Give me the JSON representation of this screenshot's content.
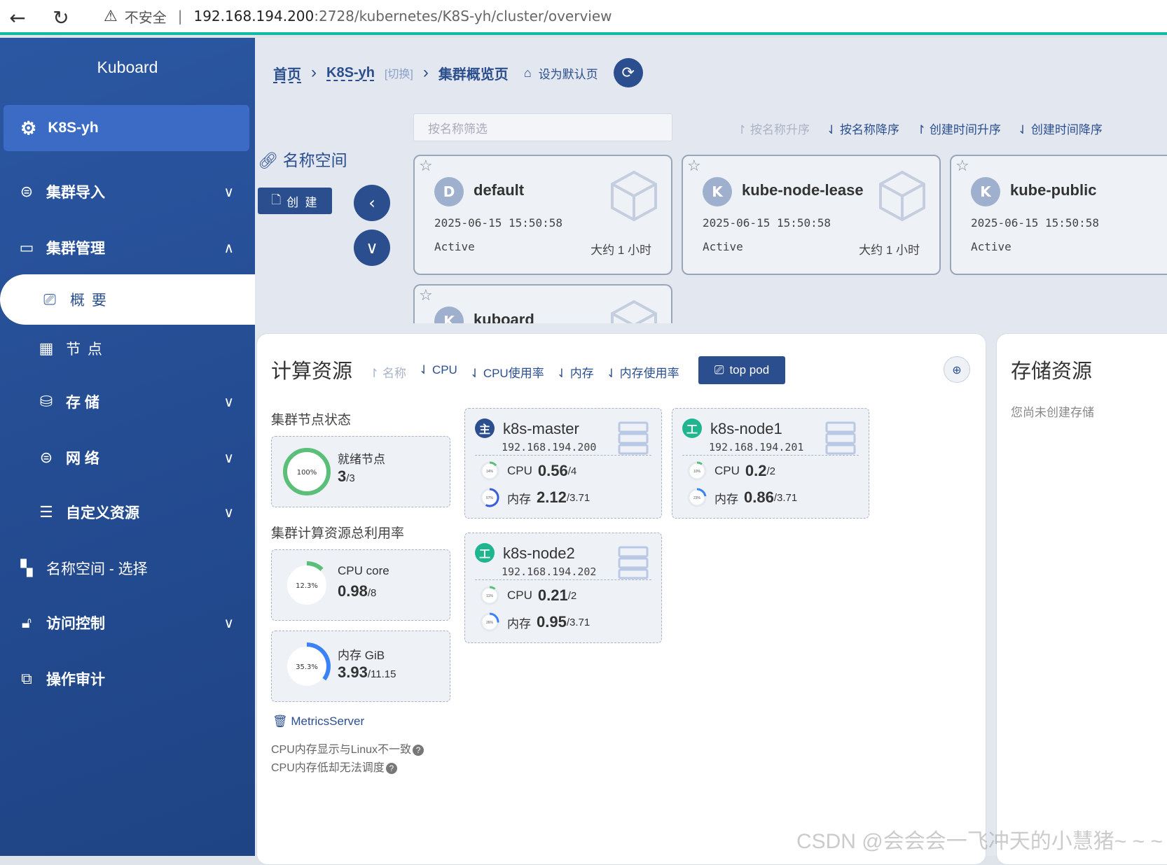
{
  "browser": {
    "insecure": "不安全",
    "url_host": "192.168.194.200",
    "url_path": ":2728/kubernetes/K8S-yh/cluster/overview"
  },
  "sidebar": {
    "brand": "Kuboard",
    "cluster": "K8S-yh",
    "items": [
      {
        "label": "集群导入"
      },
      {
        "label": "集群管理"
      },
      {
        "label": "概 要"
      },
      {
        "label": "节 点"
      },
      {
        "label": "存 储"
      },
      {
        "label": "网 络"
      },
      {
        "label": "自定义资源"
      },
      {
        "label": "名称空间 - 选择"
      },
      {
        "label": "访问控制"
      },
      {
        "label": "操作审计"
      }
    ]
  },
  "breadcrumb": {
    "home": "首页",
    "cluster": "K8S-yh",
    "switch": "[切换]",
    "current": "集群概览页",
    "set_default": "设为默认页"
  },
  "namespaces": {
    "label": "名称空间",
    "create": "创 建",
    "filter_placeholder": "按名称筛选",
    "sorts": [
      "按名称升序",
      "按名称降序",
      "创建时间升序",
      "创建时间降序"
    ],
    "cards": [
      {
        "initial": "D",
        "name": "default",
        "created": "2025-06-15 15:50:58",
        "status": "Active",
        "age": "大约 1 小时"
      },
      {
        "initial": "K",
        "name": "kube-node-lease",
        "created": "2025-06-15 15:50:58",
        "status": "Active",
        "age": "大约 1 小时"
      },
      {
        "initial": "K",
        "name": "kube-public",
        "created": "2025-06-15 15:50:58",
        "status": "Active",
        "age": ""
      },
      {
        "initial": "K",
        "name": "kuboard",
        "created": "",
        "status": "",
        "age": ""
      }
    ]
  },
  "compute": {
    "title": "计算资源",
    "sorts": [
      "名称",
      "CPU",
      "CPU使用率",
      "内存",
      "内存使用率"
    ],
    "top_pod": "top pod",
    "node_status_title": "集群节点状态",
    "ready_label": "就绪节点",
    "ready_pct": "100%",
    "ready_value": "3",
    "ready_total": "/3",
    "util_title": "集群计算资源总利用率",
    "cpu_label": "CPU core",
    "cpu_pct": "12.3%",
    "cpu_value": "0.98",
    "cpu_total": "/8",
    "mem_label": "内存 GiB",
    "mem_pct": "35.3%",
    "mem_value": "3.93",
    "mem_total": "/11.15",
    "metrics": "MetricsServer",
    "note1": "CPU内存显示与Linux不一致",
    "note2": "CPU内存低却无法调度",
    "nodes": [
      {
        "name": "k8s-master",
        "role_icon": "主",
        "ip": "192.168.194.200",
        "cpu_label": "CPU",
        "cpu": "0.56",
        "cpu_total": "/4",
        "cpu_pct": "14%",
        "mem_label": "内存",
        "mem": "2.12",
        "mem_total": "/3.71",
        "mem_pct": "57%"
      },
      {
        "name": "k8s-node1",
        "role_icon": "工",
        "ip": "192.168.194.201",
        "cpu_label": "CPU",
        "cpu": "0.2",
        "cpu_total": "/2",
        "cpu_pct": "10%",
        "mem_label": "内存",
        "mem": "0.86",
        "mem_total": "/3.71",
        "mem_pct": "23%"
      },
      {
        "name": "k8s-node2",
        "role_icon": "工",
        "ip": "192.168.194.202",
        "cpu_label": "CPU",
        "cpu": "0.21",
        "cpu_total": "/2",
        "cpu_pct": "11%",
        "mem_label": "内存",
        "mem": "0.95",
        "mem_total": "/3.71",
        "mem_pct": "26%"
      }
    ]
  },
  "storage": {
    "title": "存储资源",
    "empty": "您尚未创建存储"
  },
  "watermark": "CSDN @会会会一飞冲天的小慧猪~ ~ ~",
  "colors": {
    "primary": "#2b4f8e",
    "sidebar": "#244c92",
    "accent_teal": "#14b8a6",
    "green": "#5bbf7a",
    "blue": "#3b82f6"
  }
}
